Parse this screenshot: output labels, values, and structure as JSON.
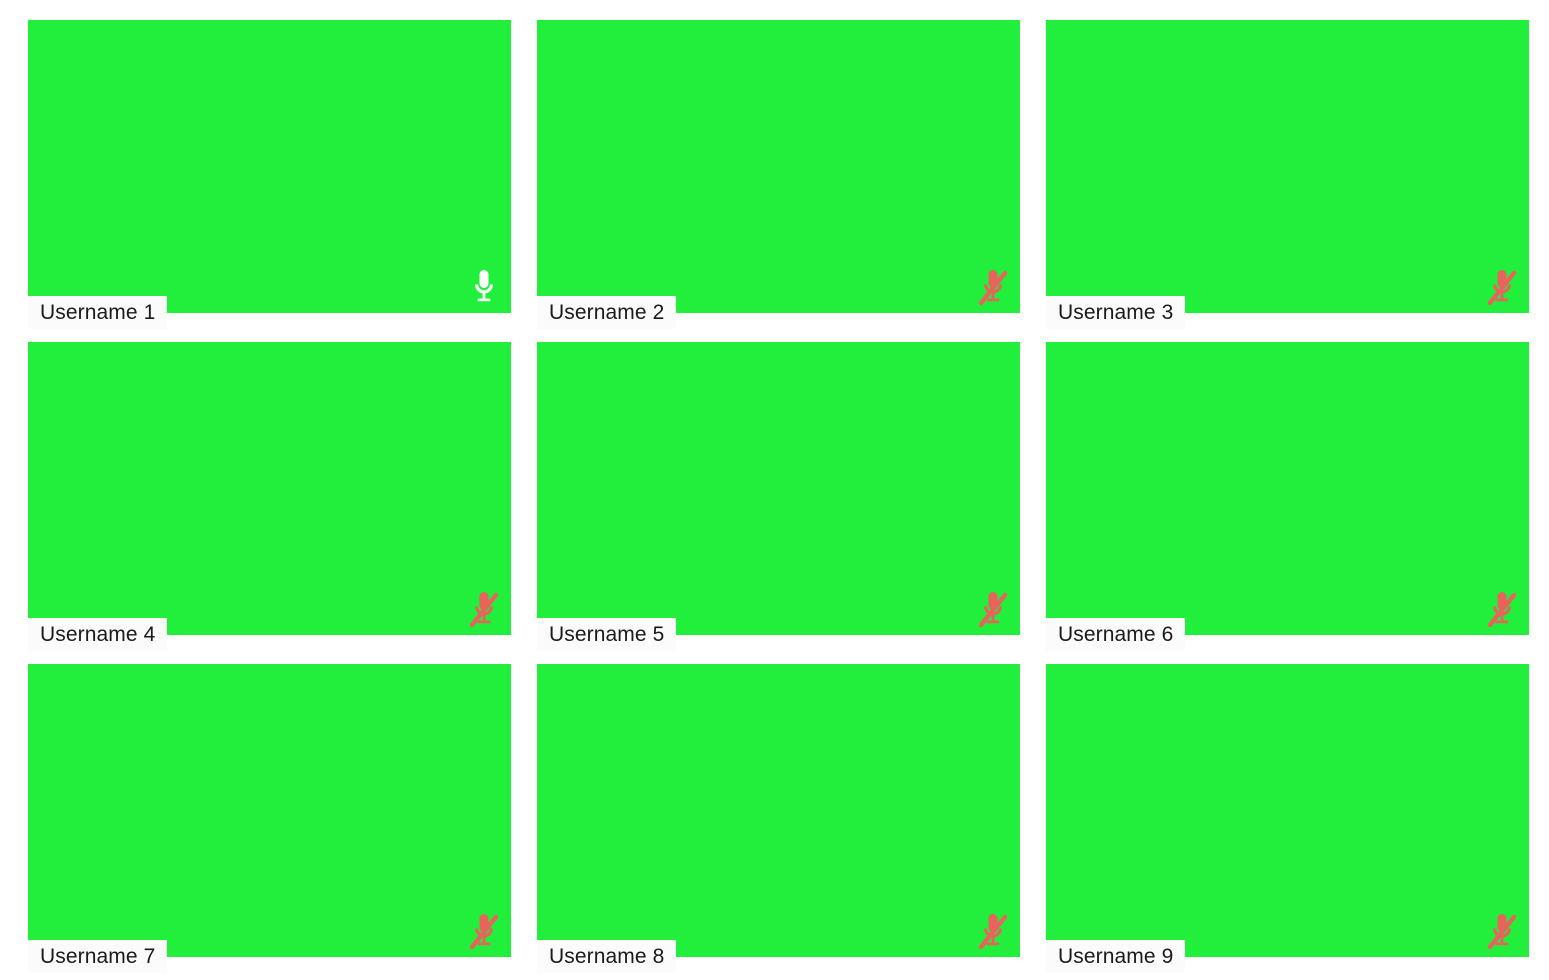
{
  "app": {
    "title": "Video Call Participant Grid",
    "background_color": "#ffffff"
  },
  "grid": {
    "columns": 3,
    "rows": 3,
    "tile_color": "#22ee3c",
    "label_background": "#fbfbfb",
    "label_text_color": "#1a1a1a",
    "mic_on_color": "#ffffff",
    "mic_off_color": "#e8635c"
  },
  "participants": [
    {
      "name": "Username 1",
      "mic_state": "unmuted",
      "mic_icon": "microphone-icon"
    },
    {
      "name": "Username 2",
      "mic_state": "muted",
      "mic_icon": "microphone-muted-icon"
    },
    {
      "name": "Username 3",
      "mic_state": "muted",
      "mic_icon": "microphone-muted-icon"
    },
    {
      "name": "Username 4",
      "mic_state": "muted",
      "mic_icon": "microphone-muted-icon"
    },
    {
      "name": "Username 5",
      "mic_state": "muted",
      "mic_icon": "microphone-muted-icon"
    },
    {
      "name": "Username 6",
      "mic_state": "muted",
      "mic_icon": "microphone-muted-icon"
    },
    {
      "name": "Username 7",
      "mic_state": "muted",
      "mic_icon": "microphone-muted-icon"
    },
    {
      "name": "Username 8",
      "mic_state": "muted",
      "mic_icon": "microphone-muted-icon"
    },
    {
      "name": "Username 9",
      "mic_state": "muted",
      "mic_icon": "microphone-muted-icon"
    }
  ]
}
